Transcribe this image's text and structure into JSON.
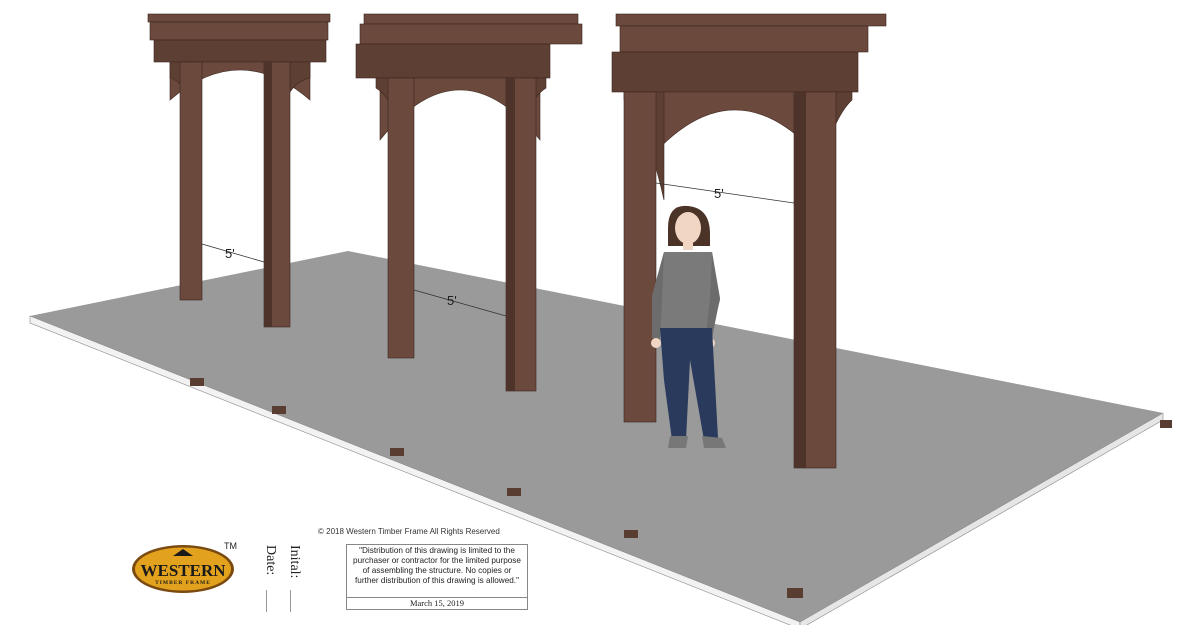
{
  "dimensions": {
    "left_label": "5'",
    "middle_label": "5'",
    "right_label": "5'"
  },
  "footer": {
    "copyright": "© 2018 Western Timber Frame All Rights Reserved",
    "date_label": "Date:",
    "initial_label": "Inital:",
    "notice": "\"Distribution of this drawing is limited to the purchaser or contractor for the limited purpose of assembling the structure.  No copies or further distribution of this drawing is allowed.\"",
    "notice_date": "March 15, 2019"
  },
  "logo": {
    "brand": "WESTERN",
    "tagline": "TIMBER FRAME",
    "trademark": "TM",
    "colors": {
      "oval": "#e3a21e",
      "oval_edge": "#7a4a10"
    }
  },
  "colors": {
    "floor": "#9a9a9a",
    "floor_edge": "#f2f2f2",
    "timber": "#6b4a3d",
    "timber_dark": "#4d3329",
    "timber_light": "#7d5b4d",
    "shirt": "#7a7a7a",
    "jeans": "#2a3a5c",
    "skin": "#f2d6c4",
    "hair": "#4b3328"
  }
}
